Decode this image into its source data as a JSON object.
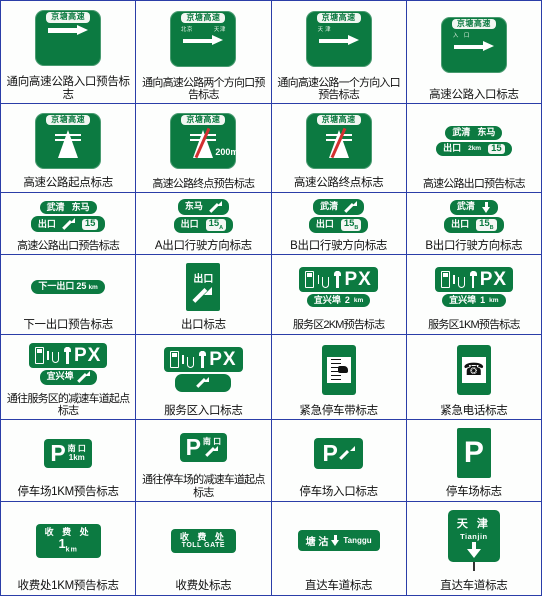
{
  "page": {
    "title": "高速公路指路标志图集",
    "columns": 4,
    "rows": 7,
    "accent_green": "#0c7a41",
    "border_blue": "#2b3ea8",
    "plate_white": "#f2f7f2",
    "slash_red": "#d23030"
  },
  "cells": [
    {
      "id": "r1c1",
      "caption": "通向高速公路入口预告标志",
      "sign": {
        "type": "gateway-arrow",
        "plate": "京塘高速",
        "directions": [],
        "arrow": "right"
      }
    },
    {
      "id": "r1c2",
      "caption": "通向高速公路两个方向口预告标志",
      "sign": {
        "type": "gateway-arrow",
        "plate": "京塘高速",
        "directions": [
          "北京",
          "天津"
        ],
        "arrow": "right"
      }
    },
    {
      "id": "r1c3",
      "caption": "通向高速公路一个方向入口预告标志",
      "sign": {
        "type": "gateway-arrow",
        "plate": "京塘高速",
        "directions": [
          "天津"
        ],
        "arrow": "right"
      }
    },
    {
      "id": "r1c4",
      "caption": "高速公路入口标志",
      "sign": {
        "type": "gateway-arrow",
        "plate": "京塘高速",
        "directions": [
          "入 口"
        ],
        "arrow": "right"
      }
    },
    {
      "id": "r2c1",
      "caption": "高速公路起点标志",
      "sign": {
        "type": "highway-glyph",
        "plate": "京塘高速",
        "slash": false,
        "distance": ""
      }
    },
    {
      "id": "r2c2",
      "caption": "高速公路终点预告标志",
      "sign": {
        "type": "highway-glyph",
        "plate": "京塘高速",
        "slash": true,
        "distance": "200m"
      }
    },
    {
      "id": "r2c3",
      "caption": "高速公路终点标志",
      "sign": {
        "type": "highway-glyph",
        "plate": "京塘高速",
        "slash": true,
        "distance": ""
      }
    },
    {
      "id": "r2c4",
      "caption": "高速公路出口预告标志",
      "sign": {
        "type": "exit-stack",
        "top_places": [
          "武清",
          "东马"
        ],
        "top_arrow": "",
        "exit_label": "出口",
        "exit_distance": "2km",
        "exit_number": "15",
        "exit_number_sub": ""
      }
    },
    {
      "id": "r3c1",
      "caption": "高速公路出口预告标志",
      "sign": {
        "type": "exit-stack",
        "top_places": [
          "武清",
          "东马"
        ],
        "top_arrow": "",
        "exit_label": "出口",
        "exit_distance": "",
        "exit_arrow": "ne",
        "exit_number": "15",
        "exit_number_sub": ""
      }
    },
    {
      "id": "r3c2",
      "caption": "A出口行驶方向标志",
      "sign": {
        "type": "exit-stack",
        "top_places": [
          "东马"
        ],
        "top_arrow": "ne",
        "exit_label": "出口",
        "exit_distance": "",
        "exit_number": "15",
        "exit_number_sub": "A"
      }
    },
    {
      "id": "r3c3",
      "caption": "B出口行驶方向标志",
      "sign": {
        "type": "exit-stack",
        "top_places": [
          "武清"
        ],
        "top_arrow": "ne",
        "exit_label": "出口",
        "exit_distance": "",
        "exit_number": "15",
        "exit_number_sub": "B"
      }
    },
    {
      "id": "r3c4",
      "caption": "B出口行驶方向标志",
      "sign": {
        "type": "exit-stack",
        "top_places": [
          "武清"
        ],
        "top_arrow": "down",
        "exit_label": "出口",
        "exit_distance": "",
        "exit_number": "15",
        "exit_number_sub": "B"
      }
    },
    {
      "id": "r4c1",
      "caption": "下一出口预告标志",
      "sign": {
        "type": "next-exit",
        "text": "下一出口",
        "distance_value": "25",
        "distance_unit": "km"
      }
    },
    {
      "id": "r4c2",
      "caption": "出口标志",
      "sign": {
        "type": "vertical-exit",
        "text": "出口",
        "arrow": "ne"
      }
    },
    {
      "id": "r4c3",
      "caption": "服务区2KM预告标志",
      "sign": {
        "type": "service-area",
        "symbols": "PX",
        "place": "宜兴埠",
        "distance_value": "2",
        "distance_unit": "km",
        "arrow": ""
      }
    },
    {
      "id": "r4c4",
      "caption": "服务区1KM预告标志",
      "sign": {
        "type": "service-area",
        "symbols": "PX",
        "place": "宜兴埠",
        "distance_value": "1",
        "distance_unit": "km",
        "arrow": ""
      }
    },
    {
      "id": "r5c1",
      "caption": "通往服务区的减速车道起点标志",
      "sign": {
        "type": "service-area",
        "symbols": "PX",
        "place": "宜兴埠",
        "distance_value": "",
        "distance_unit": "",
        "arrow": "ne"
      }
    },
    {
      "id": "r5c2",
      "caption": "服务区入口标志",
      "sign": {
        "type": "service-area",
        "symbols": "PX",
        "place": "",
        "distance_value": "",
        "distance_unit": "",
        "arrow": "ne"
      }
    },
    {
      "id": "r5c3",
      "caption": "紧急停车带标志",
      "sign": {
        "type": "emergency",
        "pictogram": "emergency-bay"
      }
    },
    {
      "id": "r5c4",
      "caption": "紧急电话标志",
      "sign": {
        "type": "emergency",
        "pictogram": "telephone",
        "glyph": "☎"
      }
    },
    {
      "id": "r6c1",
      "caption": "停车场1KM预告标志",
      "sign": {
        "type": "parking-panel",
        "letter": "P",
        "place": "南 口",
        "distance": "1km",
        "arrow": ""
      }
    },
    {
      "id": "r6c2",
      "caption": "通往停车场的减速车道起点标志",
      "sign": {
        "type": "parking-panel",
        "letter": "P",
        "place": "南 口",
        "distance": "",
        "arrow": "ne"
      }
    },
    {
      "id": "r6c3",
      "caption": "停车场入口标志",
      "sign": {
        "type": "parking-panel",
        "letter": "P",
        "place": "",
        "distance": "",
        "arrow": "ne"
      }
    },
    {
      "id": "r6c4",
      "caption": "停车场标志",
      "sign": {
        "type": "parking-box",
        "letter": "P"
      }
    },
    {
      "id": "r7c1",
      "caption": "收费处1KM预告标志",
      "sign": {
        "type": "toll",
        "zh": "收 费 处",
        "distance_value": "1",
        "distance_unit": "km",
        "en": ""
      }
    },
    {
      "id": "r7c2",
      "caption": "收费处标志",
      "sign": {
        "type": "toll",
        "zh": "收 费 处",
        "distance_value": "",
        "distance_unit": "",
        "en": "TOLL GATE"
      }
    },
    {
      "id": "r7c3",
      "caption": "直达车道标志",
      "sign": {
        "type": "through-bar",
        "zh": "塘 沽",
        "en": "Tanggu",
        "arrow": "down"
      }
    },
    {
      "id": "r7c4",
      "caption": "直达车道标志",
      "sign": {
        "type": "through-box",
        "zh": "天 津",
        "en": "Tianjin",
        "arrow": "down"
      }
    }
  ]
}
